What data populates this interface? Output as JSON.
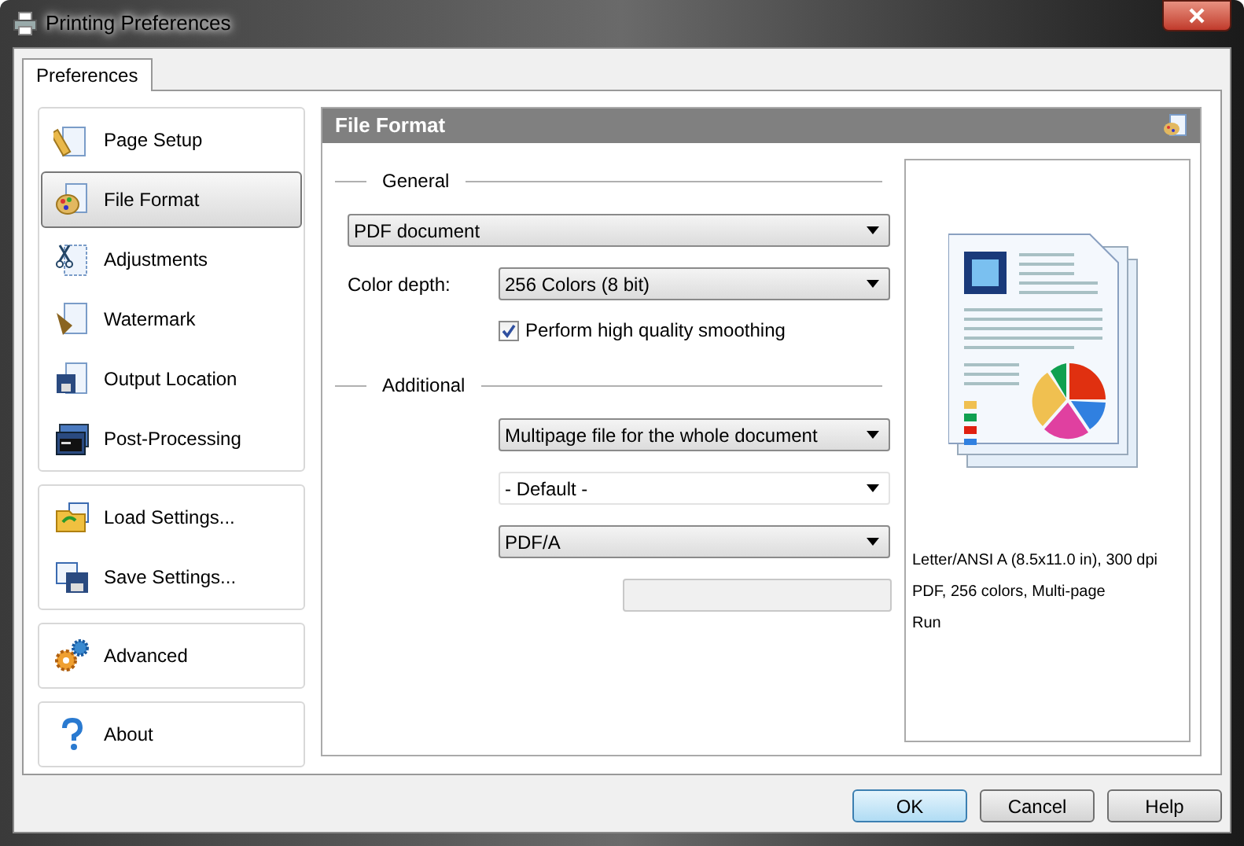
{
  "window": {
    "title": "Printing Preferences"
  },
  "tabs": [
    {
      "label": "Preferences",
      "selected": true
    }
  ],
  "sidebar": {
    "groups": [
      {
        "items": [
          {
            "label": "Page Setup",
            "selected": false
          },
          {
            "label": "File Format",
            "selected": true
          },
          {
            "label": "Adjustments",
            "selected": false
          },
          {
            "label": "Watermark",
            "selected": false
          },
          {
            "label": "Output Location",
            "selected": false
          },
          {
            "label": "Post-Processing",
            "selected": false
          }
        ]
      },
      {
        "items": [
          {
            "label": "Load Settings...",
            "selected": false
          },
          {
            "label": "Save Settings...",
            "selected": false
          }
        ]
      },
      {
        "items": [
          {
            "label": "Advanced",
            "selected": false
          }
        ]
      },
      {
        "items": [
          {
            "label": "About",
            "selected": false
          }
        ]
      }
    ]
  },
  "panel": {
    "title": "File Format",
    "general": {
      "heading": "General",
      "format": "PDF document",
      "color_depth_label": "Color depth:",
      "color_depth": "256 Colors (8 bit)",
      "smoothing": {
        "label": "Perform high quality smoothing",
        "checked": true
      }
    },
    "additional": {
      "heading": "Additional",
      "fields": [
        {
          "kind": "dropdown",
          "value": "Multipage file for the whole document"
        },
        {
          "kind": "combo",
          "value": "- Default -"
        },
        {
          "kind": "dropdown",
          "value": "PDF/A"
        },
        {
          "kind": "field",
          "disabled": true
        }
      ]
    },
    "preview": {
      "summary": [
        "Letter/ANSI A (8.5x11.0 in), 300 dpi",
        "PDF, 256 colors, Multi-page",
        "Run"
      ]
    }
  },
  "buttons": [
    {
      "label": "OK",
      "default": true
    },
    {
      "label": "Cancel",
      "default": false
    },
    {
      "label": "Help",
      "default": false
    }
  ]
}
